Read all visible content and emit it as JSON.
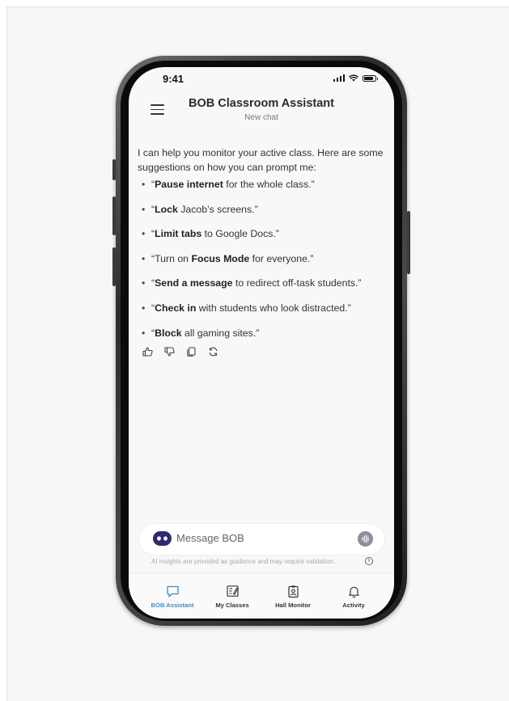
{
  "status": {
    "time": "9:41"
  },
  "header": {
    "title": "BOB Classroom Assistant",
    "subtitle": "New chat"
  },
  "chat": {
    "intro": "I can help you monitor your active class. Here are some suggestions on how you can prompt me:",
    "suggestions": [
      {
        "open": "“",
        "bold": "Pause internet",
        "rest": " for the whole class.”"
      },
      {
        "open": "“",
        "bold": "Lock",
        "rest": " Jacob’s screens.”"
      },
      {
        "open": "“",
        "bold": "Limit tabs",
        "rest": " to Google Docs.”"
      },
      {
        "open": "“Turn on ",
        "bold": "Focus Mode",
        "rest": " for everyone.”"
      },
      {
        "open": "“",
        "bold": "Send a message",
        "rest": " to redirect off-task students.”"
      },
      {
        "open": "“",
        "bold": "Check in",
        "rest": " with students who look distracted.”"
      },
      {
        "open": "“",
        "bold": "Block",
        "rest": " all gaming sites.”"
      }
    ],
    "actions": [
      "thumbs-up-icon",
      "thumbs-down-icon",
      "copy-icon",
      "regenerate-icon"
    ]
  },
  "composer": {
    "placeholder": "Message BOB",
    "disclaimer": "AI insights are provided as guidance and may require validation."
  },
  "tabs": [
    {
      "label": "BOB Assistant",
      "icon": "chat-bubble-icon",
      "active": true
    },
    {
      "label": "My Classes",
      "icon": "classes-icon",
      "active": false
    },
    {
      "label": "Hall Monitor",
      "icon": "badge-icon",
      "active": false
    },
    {
      "label": "Activity",
      "icon": "bell-icon",
      "active": false
    }
  ],
  "colors": {
    "accent": "#3d8ec9",
    "background": "#f8f8f8"
  }
}
